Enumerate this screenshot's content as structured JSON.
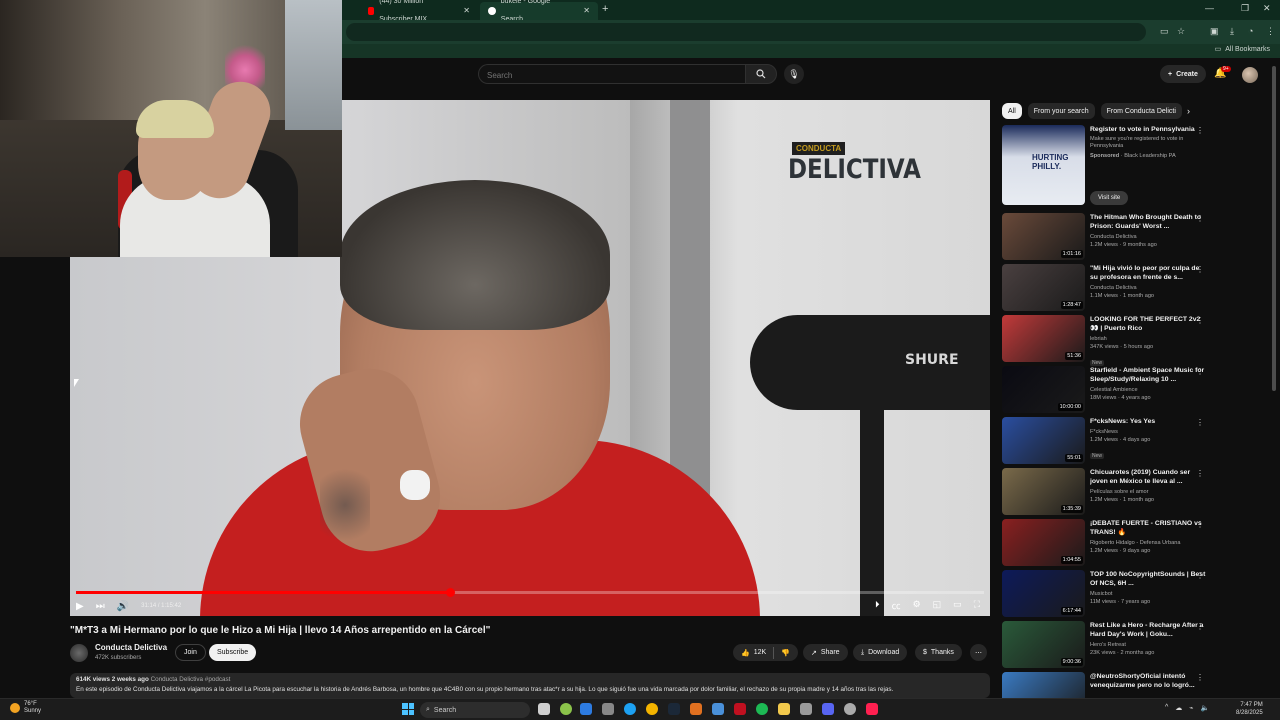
{
  "browser": {
    "tabs": [
      {
        "label": "(44) 30 Million Subscriber MIX",
        "favicon_color": "#ff0000"
      },
      {
        "label": "bukele - Google Search",
        "favicon_color": "#ffffff"
      }
    ],
    "bookmarks_label": "All Bookmarks"
  },
  "header": {
    "search_placeholder": "Search",
    "create_label": "Create",
    "notifications_badge": "9+"
  },
  "video": {
    "logo_top": "CONDUCTA",
    "logo_main": "DELICTIVA",
    "mic_brand": "SHURE",
    "time": "31:14 / 1:15:42",
    "progress_fraction": 0.412,
    "title": "\"M*T3 a Mi Hermano por lo que le Hizo a Mi Hija | llevo 14 Años arrepentido en la Cárcel\"",
    "channel": "Conducta Delictiva",
    "subscribers": "472K subscribers",
    "join_label": "Join",
    "subscribe_label": "Subscribe",
    "likes": "12K",
    "share_label": "Share",
    "download_label": "Download",
    "thanks_label": "Thanks",
    "views_date": "614K views  2 weeks ago",
    "tags": "Conducta Delictiva #podcast",
    "description": "En este episodio de Conducta Delictiva viajamos a la cárcel La Picota para escuchar la historia de Andrés Barbosa, un hombre que 4C4B0 con su propio hermano tras atac*r a su hija. Lo que siguió fue una vida marcada por dolor familiar, el rechazo de su propia madre y 14 años tras las rejas."
  },
  "sidebar": {
    "chips": [
      "All",
      "From your search",
      "From Conducta Delicti"
    ],
    "ad": {
      "title": "Register to vote in Pennsylvania",
      "desc": "Make sure you're registered to vote in Pennsylvania",
      "sponsor": "Sponsored",
      "sponsor_name": "· Black Leadership PA",
      "cta": "Visit site",
      "thumb_text": "HURTING PHILLY."
    },
    "items": [
      {
        "title": "The Hitman Who Brought Death to Prison: Guards' Worst ...",
        "channel": "Conducta Delictiva",
        "meta": "1.2M views · 9 months ago",
        "duration": "1:01:16",
        "new": "",
        "color": "#6a4a3a"
      },
      {
        "title": "\"Mi Hija vivió lo peor por culpa de su profesora en frente de s...",
        "channel": "Conducta Delictiva",
        "meta": "1.1M views · 1 month ago",
        "duration": "1:28:47",
        "new": "",
        "color": "#4a4040"
      },
      {
        "title": "LOOKING FOR THE PERFECT 2v2 👀 | Puerto Rico",
        "channel": "lebriah",
        "meta": "347K views · 5 hours ago",
        "duration": "51:36",
        "new": "New",
        "color": "#c23a3a"
      },
      {
        "title": "Starfield - Ambient Space Music for Sleep/Study/Relaxing 10 ...",
        "channel": "Celestial Ambience",
        "meta": "18M views · 4 years ago",
        "duration": "10:00:00",
        "new": "",
        "color": "#0a0a12"
      },
      {
        "title": "F*cksNews: Yes Yes",
        "channel": "F*cksNews",
        "meta": "1.2M views · 4 days ago",
        "duration": "55:01",
        "new": "New",
        "color": "#2a4ea0"
      },
      {
        "title": "Chicuarotes (2019)  Cuando ser joven en México te lleva al ...",
        "channel": "Películas sobre el amor",
        "meta": "1.2M views · 1 month ago",
        "duration": "1:35:39",
        "new": "",
        "color": "#7a6a4a"
      },
      {
        "title": "¡DEBATE FUERTE - CRISTIANO vs TRANS! 🔥",
        "channel": "Rigoberto Hidalgo - Defensa Urbana",
        "meta": "1.2M views · 9 days ago",
        "duration": "1:04:55",
        "new": "",
        "color": "#8a2020"
      },
      {
        "title": "TOP 100 NoCopyrightSounds | Best Of NCS, 6H ...",
        "channel": "Musicbot",
        "meta": "11M views · 7 years ago",
        "duration": "6:17:44",
        "new": "",
        "color": "#0d1a5a"
      },
      {
        "title": "Rest Like a Hero - Recharge After a Hard Day's Work | Goku...",
        "channel": "Hero's Retreat",
        "meta": "23K views · 2 months ago",
        "duration": "9:00:36",
        "new": "",
        "color": "#2a5a3a"
      },
      {
        "title": "@NeutroShortyOficial intentó venequizarme pero no lo logró...",
        "channel": "",
        "meta": "",
        "duration": "",
        "new": "",
        "color": "#3a7ac2"
      }
    ]
  },
  "taskbar": {
    "temp": "76°F",
    "weather": "Sunny",
    "search_label": "Search",
    "time": "7:47 PM",
    "date": "8/28/2025"
  }
}
